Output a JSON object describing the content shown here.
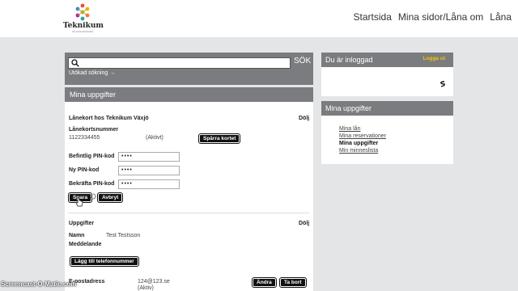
{
  "logo": {
    "name": "Teknikum",
    "tagline": "det stora skolverket"
  },
  "nav": [
    "Startsida",
    "Mina sidor/Låna om",
    "Låna"
  ],
  "search": {
    "button": "SÖK",
    "advanced": "Utökad sökning →"
  },
  "main": {
    "title": "Mina uppgifter",
    "card": {
      "title": "Lånekort hos Teknikum Växjö",
      "hide": "Dölj",
      "number_label": "Lånekortsnummer",
      "number": "1122334455",
      "status": "(Aktivt)",
      "block_button": "Spärra kortet"
    },
    "pin": {
      "current_label": "Befintlig PIN-kod",
      "new_label": "Ny PIN-kod",
      "confirm_label": "Bekräfta PIN-kod",
      "mask": "••••",
      "save": "Spara",
      "cancel": "Avbryt"
    },
    "details": {
      "title": "Uppgifter",
      "hide": "Dölj",
      "name_label": "Namn",
      "name": "Test Testsson",
      "message_label": "Meddelande",
      "add_phone": "Lägg till telefonnummer",
      "email_label": "E-postadress",
      "email": "124@123.se",
      "email_status": "(Aktiv)",
      "change": "Ändra",
      "remove": "Ta bort"
    }
  },
  "sidebar": {
    "logged_in": "Du är inloggad",
    "logout": "Logga ut",
    "section_title": "Mina uppgifter",
    "links": [
      "Mina lån",
      "Mina reservationer",
      "Mina uppgifter",
      "Min minneslista"
    ]
  },
  "watermark": "Screencast-O-Matic.com",
  "colors": {
    "panel_header": "#7a7c80",
    "logout": "#f3c300",
    "background": "#e4e5e7"
  }
}
